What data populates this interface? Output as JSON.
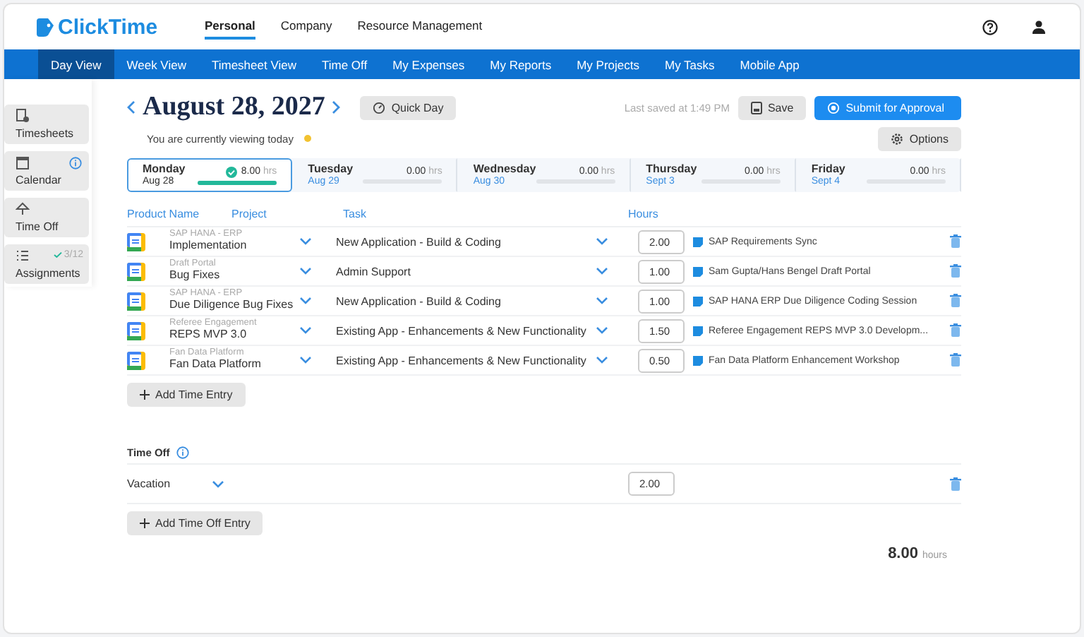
{
  "logo": "ClickTime",
  "top_tabs": [
    {
      "label": "Personal",
      "selected": true
    },
    {
      "label": "Company",
      "selected": false
    },
    {
      "label": "Resource Management",
      "selected": false
    }
  ],
  "nav_tabs": [
    {
      "label": "Day View",
      "selected": true
    },
    {
      "label": "Week View",
      "selected": false
    },
    {
      "label": "Timesheet View",
      "selected": false
    },
    {
      "label": "Time Off",
      "selected": false
    },
    {
      "label": "My Expenses",
      "selected": false
    },
    {
      "label": "My Reports",
      "selected": false
    },
    {
      "label": "My Projects",
      "selected": false
    },
    {
      "label": "My Tasks",
      "selected": false
    },
    {
      "label": "Mobile App",
      "selected": false
    }
  ],
  "sidebar": [
    {
      "kind": "timesheets",
      "label": "Timesheets",
      "info": false
    },
    {
      "kind": "calendar",
      "label": "Calendar",
      "info": true
    },
    {
      "kind": "timeoff",
      "label": "Time Off",
      "info": false
    },
    {
      "kind": "assignments",
      "label": "Assignments",
      "info": false,
      "badge": "3/12"
    }
  ],
  "date_title": "August 28, 2027",
  "quick_day": "Quick Day",
  "viewing_note": "You are currently viewing today",
  "last_saved": "Last saved at 1:49 PM",
  "save": "Save",
  "submit": "Submit for Approval",
  "options": "Options",
  "days": [
    {
      "name": "Monday",
      "date": "Aug 28",
      "hours": "8.00",
      "unit": "hrs",
      "level": 1,
      "selected": true,
      "done": true
    },
    {
      "name": "Tuesday",
      "date": "Aug 29",
      "hours": "0.00",
      "unit": "hrs",
      "level": 0,
      "selected": false,
      "done": false
    },
    {
      "name": "Wednesday",
      "date": "Aug 30",
      "hours": "0.00",
      "unit": "hrs",
      "level": 0,
      "selected": false,
      "done": false
    },
    {
      "name": "Thursday",
      "date": "Sept 3",
      "hours": "0.00",
      "unit": "hrs",
      "level": 0,
      "selected": false,
      "done": false
    },
    {
      "name": "Friday",
      "date": "Sept 4",
      "hours": "0.00",
      "unit": "hrs",
      "level": 0,
      "selected": false,
      "done": false
    }
  ],
  "columns": [
    "Product Name",
    "Project",
    "Task",
    "Hours"
  ],
  "entries": [
    {
      "client": "SAP HANA - ERP",
      "project": "Implementation",
      "task": "New Application - Build & Coding",
      "hours": "2.00",
      "note": "SAP Requirements Sync"
    },
    {
      "client": "Draft Portal",
      "project": "Bug Fixes",
      "task": "Admin Support",
      "hours": "1.00",
      "note": "Sam Gupta/Hans Bengel Draft Portal"
    },
    {
      "client": "SAP HANA - ERP",
      "project": "Due Diligence Bug Fixes",
      "task": "New Application - Build & Coding",
      "hours": "1.00",
      "note": "SAP HANA ERP Due Diligence Coding Session"
    },
    {
      "client": "Referee Engagement",
      "project": "REPS MVP 3.0",
      "task": "Existing App - Enhancements & New Functionality",
      "hours": "1.50",
      "note": "Referee Engagement REPS MVP 3.0 Developm..."
    },
    {
      "client": "Fan Data Platform",
      "project": "Fan Data Platform",
      "task": "Existing App - Enhancements & New Functionality",
      "hours": "0.50",
      "note": "Fan Data Platform Enhancement Workshop"
    }
  ],
  "add_entry": "Add Time Entry",
  "time_off": {
    "title": "Time Off",
    "entries": [
      {
        "type": "Vacation",
        "hours": "2.00"
      }
    ]
  },
  "add_time_off": "Add Time Off Entry",
  "total": {
    "value": "8.00",
    "unit": "hours"
  }
}
